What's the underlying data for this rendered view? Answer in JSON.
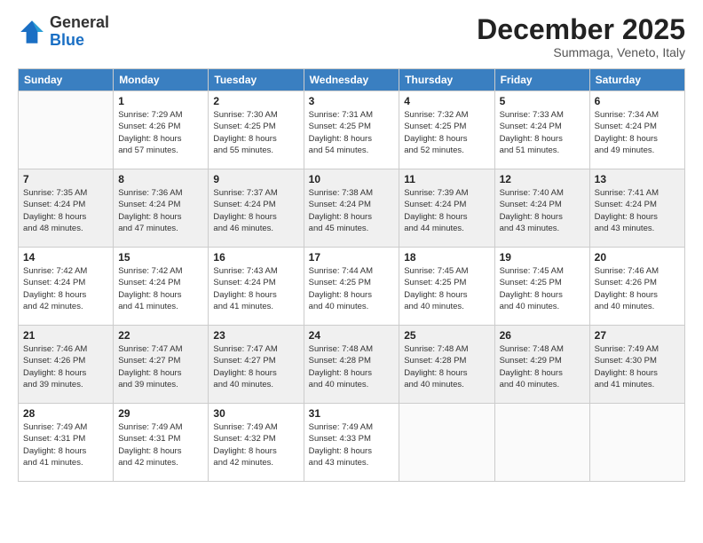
{
  "header": {
    "logo": {
      "general": "General",
      "blue": "Blue"
    },
    "title": "December 2025",
    "subtitle": "Summaga, Veneto, Italy"
  },
  "calendar": {
    "columns": [
      "Sunday",
      "Monday",
      "Tuesday",
      "Wednesday",
      "Thursday",
      "Friday",
      "Saturday"
    ],
    "weeks": [
      [
        {
          "day": "",
          "info": ""
        },
        {
          "day": "1",
          "info": "Sunrise: 7:29 AM\nSunset: 4:26 PM\nDaylight: 8 hours\nand 57 minutes."
        },
        {
          "day": "2",
          "info": "Sunrise: 7:30 AM\nSunset: 4:25 PM\nDaylight: 8 hours\nand 55 minutes."
        },
        {
          "day": "3",
          "info": "Sunrise: 7:31 AM\nSunset: 4:25 PM\nDaylight: 8 hours\nand 54 minutes."
        },
        {
          "day": "4",
          "info": "Sunrise: 7:32 AM\nSunset: 4:25 PM\nDaylight: 8 hours\nand 52 minutes."
        },
        {
          "day": "5",
          "info": "Sunrise: 7:33 AM\nSunset: 4:24 PM\nDaylight: 8 hours\nand 51 minutes."
        },
        {
          "day": "6",
          "info": "Sunrise: 7:34 AM\nSunset: 4:24 PM\nDaylight: 8 hours\nand 49 minutes."
        }
      ],
      [
        {
          "day": "7",
          "info": "Sunrise: 7:35 AM\nSunset: 4:24 PM\nDaylight: 8 hours\nand 48 minutes."
        },
        {
          "day": "8",
          "info": "Sunrise: 7:36 AM\nSunset: 4:24 PM\nDaylight: 8 hours\nand 47 minutes."
        },
        {
          "day": "9",
          "info": "Sunrise: 7:37 AM\nSunset: 4:24 PM\nDaylight: 8 hours\nand 46 minutes."
        },
        {
          "day": "10",
          "info": "Sunrise: 7:38 AM\nSunset: 4:24 PM\nDaylight: 8 hours\nand 45 minutes."
        },
        {
          "day": "11",
          "info": "Sunrise: 7:39 AM\nSunset: 4:24 PM\nDaylight: 8 hours\nand 44 minutes."
        },
        {
          "day": "12",
          "info": "Sunrise: 7:40 AM\nSunset: 4:24 PM\nDaylight: 8 hours\nand 43 minutes."
        },
        {
          "day": "13",
          "info": "Sunrise: 7:41 AM\nSunset: 4:24 PM\nDaylight: 8 hours\nand 43 minutes."
        }
      ],
      [
        {
          "day": "14",
          "info": "Sunrise: 7:42 AM\nSunset: 4:24 PM\nDaylight: 8 hours\nand 42 minutes."
        },
        {
          "day": "15",
          "info": "Sunrise: 7:42 AM\nSunset: 4:24 PM\nDaylight: 8 hours\nand 41 minutes."
        },
        {
          "day": "16",
          "info": "Sunrise: 7:43 AM\nSunset: 4:24 PM\nDaylight: 8 hours\nand 41 minutes."
        },
        {
          "day": "17",
          "info": "Sunrise: 7:44 AM\nSunset: 4:25 PM\nDaylight: 8 hours\nand 40 minutes."
        },
        {
          "day": "18",
          "info": "Sunrise: 7:45 AM\nSunset: 4:25 PM\nDaylight: 8 hours\nand 40 minutes."
        },
        {
          "day": "19",
          "info": "Sunrise: 7:45 AM\nSunset: 4:25 PM\nDaylight: 8 hours\nand 40 minutes."
        },
        {
          "day": "20",
          "info": "Sunrise: 7:46 AM\nSunset: 4:26 PM\nDaylight: 8 hours\nand 40 minutes."
        }
      ],
      [
        {
          "day": "21",
          "info": "Sunrise: 7:46 AM\nSunset: 4:26 PM\nDaylight: 8 hours\nand 39 minutes."
        },
        {
          "day": "22",
          "info": "Sunrise: 7:47 AM\nSunset: 4:27 PM\nDaylight: 8 hours\nand 39 minutes."
        },
        {
          "day": "23",
          "info": "Sunrise: 7:47 AM\nSunset: 4:27 PM\nDaylight: 8 hours\nand 40 minutes."
        },
        {
          "day": "24",
          "info": "Sunrise: 7:48 AM\nSunset: 4:28 PM\nDaylight: 8 hours\nand 40 minutes."
        },
        {
          "day": "25",
          "info": "Sunrise: 7:48 AM\nSunset: 4:28 PM\nDaylight: 8 hours\nand 40 minutes."
        },
        {
          "day": "26",
          "info": "Sunrise: 7:48 AM\nSunset: 4:29 PM\nDaylight: 8 hours\nand 40 minutes."
        },
        {
          "day": "27",
          "info": "Sunrise: 7:49 AM\nSunset: 4:30 PM\nDaylight: 8 hours\nand 41 minutes."
        }
      ],
      [
        {
          "day": "28",
          "info": "Sunrise: 7:49 AM\nSunset: 4:31 PM\nDaylight: 8 hours\nand 41 minutes."
        },
        {
          "day": "29",
          "info": "Sunrise: 7:49 AM\nSunset: 4:31 PM\nDaylight: 8 hours\nand 42 minutes."
        },
        {
          "day": "30",
          "info": "Sunrise: 7:49 AM\nSunset: 4:32 PM\nDaylight: 8 hours\nand 42 minutes."
        },
        {
          "day": "31",
          "info": "Sunrise: 7:49 AM\nSunset: 4:33 PM\nDaylight: 8 hours\nand 43 minutes."
        },
        {
          "day": "",
          "info": ""
        },
        {
          "day": "",
          "info": ""
        },
        {
          "day": "",
          "info": ""
        }
      ]
    ]
  }
}
